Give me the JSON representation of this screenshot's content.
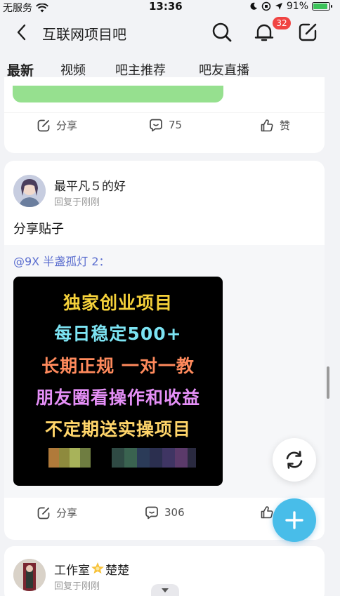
{
  "status_bar": {
    "carrier": "无服务",
    "time": "13:36",
    "battery_text": "91%",
    "battery_level": 0.91
  },
  "nav": {
    "title": "互联网项目吧",
    "notification_count": "32"
  },
  "tabs": [
    {
      "label": "最新",
      "active": true
    },
    {
      "label": "视频",
      "active": false
    },
    {
      "label": "吧主推荐",
      "active": false
    },
    {
      "label": "吧友直播",
      "active": false
    }
  ],
  "post1": {
    "share_label": "分享",
    "comment_count": "75",
    "like_label": "赞"
  },
  "post2": {
    "username": "最平凡５的好",
    "subline": "回复于刚刚",
    "text": "分享贴子",
    "mention": "@9X 半盏孤灯 2：",
    "promo_lines": [
      {
        "text": "独家创业项目",
        "color": "#f5d13a"
      },
      {
        "text": "每日稳定500+",
        "color": "#7ce3f2"
      },
      {
        "text": "长期正规 一对一教",
        "color": "#ff8a5c"
      },
      {
        "text": "朋友圈看操作和收益",
        "color": "#e58ff7"
      },
      {
        "text": "不定期送实操项目",
        "color": "#ffd56a"
      }
    ],
    "share_label": "分享",
    "comment_count": "306"
  },
  "post3": {
    "username_prefix": "工作室",
    "username_suffix": "楚楚",
    "subline": "回复于刚刚"
  },
  "colors": {
    "accent": "#48bde9",
    "badge": "#f04342",
    "tab_indicator": "#3dc3f0"
  }
}
